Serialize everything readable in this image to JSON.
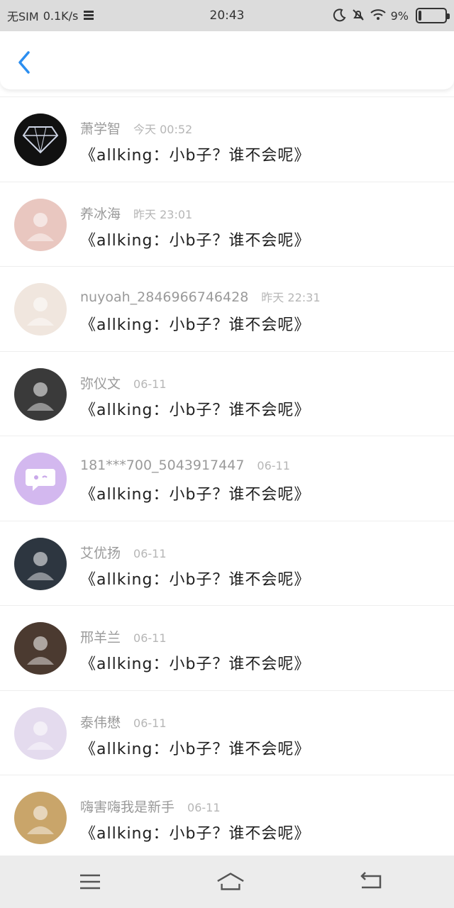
{
  "status_bar": {
    "carrier": "无SIM",
    "speed": "0.1K/s",
    "time": "20:43",
    "battery": "9%"
  },
  "icons": {
    "back": "back-icon",
    "menu": "menu-icon",
    "home": "home-icon",
    "return": "return-icon"
  },
  "colors": {
    "accent": "#2b8ef0"
  },
  "messages": [
    {
      "name": "萧学智",
      "time": "今天 00:52",
      "text": "《allking：小b子？谁不会呢》",
      "avatar_bg": "#111111",
      "avatar_icon": "diamond-avatar"
    },
    {
      "name": "养冰海",
      "time": "昨天 23:01",
      "text": "《allking：小b子？谁不会呢》",
      "avatar_bg": "#e9c7c0",
      "avatar_icon": "anime-avatar"
    },
    {
      "name": "nuyoah_2846966746428",
      "time": "昨天 22:31",
      "text": "《allking：小b子？谁不会呢》",
      "avatar_bg": "#f0e6de",
      "avatar_icon": "photo-avatar"
    },
    {
      "name": "弥仪文",
      "time": "06-11",
      "text": "《allking：小b子？谁不会呢》",
      "avatar_bg": "#3a3a3a",
      "avatar_icon": "photo-avatar"
    },
    {
      "name": "181***700_5043917447",
      "time": "06-11",
      "text": "《allking：小b子？谁不会呢》",
      "avatar_bg": "#d3b8ef",
      "avatar_icon": "chat-bubble-avatar"
    },
    {
      "name": "艾优扬",
      "time": "06-11",
      "text": "《allking：小b子？谁不会呢》",
      "avatar_bg": "#2d3640",
      "avatar_icon": "photo-avatar"
    },
    {
      "name": "邢羊兰",
      "time": "06-11",
      "text": "《allking：小b子？谁不会呢》",
      "avatar_bg": "#4b3a30",
      "avatar_icon": "photo-avatar"
    },
    {
      "name": "泰伟懋",
      "time": "06-11",
      "text": "《allking：小b子？谁不会呢》",
      "avatar_bg": "#e4dbee",
      "avatar_icon": "anime-avatar"
    },
    {
      "name": "嗨害嗨我是新手",
      "time": "06-11",
      "text": "《allking：小b子？谁不会呢》",
      "avatar_bg": "#c9a56a",
      "avatar_icon": "cartoon-avatar"
    }
  ]
}
